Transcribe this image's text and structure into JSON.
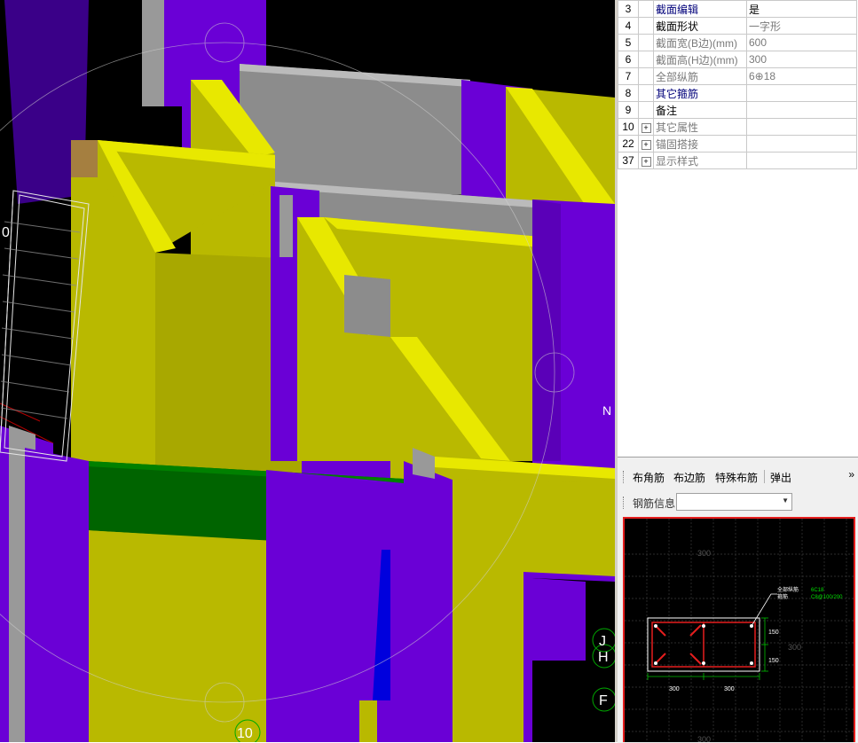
{
  "viewport": {
    "axis_labels": [
      "10",
      "0",
      "J",
      "H",
      "F",
      "N"
    ]
  },
  "properties": {
    "rows": [
      {
        "num": "3",
        "expand": false,
        "name": "截面编辑",
        "name_style": "blue",
        "value": "是",
        "value_style": "blk"
      },
      {
        "num": "4",
        "expand": false,
        "name": "截面形状",
        "name_style": "blk",
        "value": "一字形",
        "value_style": "gray"
      },
      {
        "num": "5",
        "expand": false,
        "name": "截面宽(B边)(mm)",
        "name_style": "gray",
        "value": "600",
        "value_style": "gray"
      },
      {
        "num": "6",
        "expand": false,
        "name": "截面高(H边)(mm)",
        "name_style": "gray",
        "value": "300",
        "value_style": "gray"
      },
      {
        "num": "7",
        "expand": false,
        "name": "全部纵筋",
        "name_style": "gray",
        "value": "6⊕18",
        "value_style": "gray"
      },
      {
        "num": "8",
        "expand": false,
        "name": "其它箍筋",
        "name_style": "blue",
        "value": "",
        "value_style": "gray"
      },
      {
        "num": "9",
        "expand": false,
        "name": "备注",
        "name_style": "blk",
        "value": "",
        "value_style": "gray"
      },
      {
        "num": "10",
        "expand": true,
        "name": "其它属性",
        "name_style": "gray",
        "value": "",
        "value_style": "gray"
      },
      {
        "num": "22",
        "expand": true,
        "name": "锚固搭接",
        "name_style": "gray",
        "value": "",
        "value_style": "gray"
      },
      {
        "num": "37",
        "expand": true,
        "name": "显示样式",
        "name_style": "gray",
        "value": "",
        "value_style": "gray"
      }
    ]
  },
  "toolbar": {
    "corner_bar": "布角筋",
    "edge_bar": "布边筋",
    "special_bar": "特殊布筋",
    "popout": "弹出",
    "more": "»"
  },
  "rebar_info": {
    "label": "钢筋信息",
    "value": ""
  },
  "section_preview": {
    "dim_top": "300",
    "dim_right": "300",
    "dim_bottom": "300",
    "dim_150_top": "150",
    "dim_150_bottom": "150",
    "dim_left_500": "300",
    "dim_right_500": "300",
    "leader_label_1": "全部纵筋",
    "leader_label_2": "箍筋",
    "leader_value_1": "6C18",
    "leader_value_2": "C8@100/200"
  },
  "colors": {
    "wall_yellow": "#b9b900",
    "wall_yellow_top": "#e8e800",
    "column_purple": "#6a00d6",
    "beam_green": "#006400",
    "slab_gray": "#8c8c8c",
    "selection_red": "#e51e1e"
  }
}
